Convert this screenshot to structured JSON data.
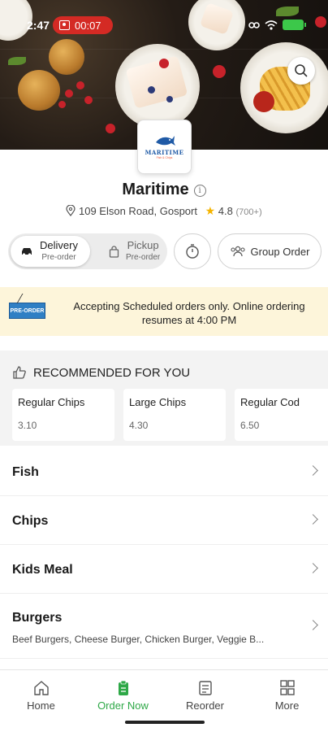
{
  "status_bar": {
    "time": "2:47",
    "recording": "00:07"
  },
  "restaurant": {
    "logo_text": "MARITIME",
    "logo_sub": "Fish & Chips",
    "name": "Maritime",
    "info_glyph": "i",
    "address": "109 Elson Road, Gosport",
    "rating": "4.8",
    "rating_count": "(700+)"
  },
  "order_modes": [
    {
      "label": "Delivery",
      "sub": "Pre-order",
      "active": true
    },
    {
      "label": "Pickup",
      "sub": "Pre-order",
      "active": false
    }
  ],
  "group_order_label": "Group Order",
  "banner": {
    "tag": "PRE-ORDER",
    "message": "Accepting Scheduled orders only. Online ordering resumes at 4:00 PM"
  },
  "recommended": {
    "heading": "RECOMMENDED FOR YOU",
    "items": [
      {
        "name": "Regular Chips",
        "price": "3.10"
      },
      {
        "name": "Large Chips",
        "price": "4.30"
      },
      {
        "name": "Regular Cod",
        "price": "6.50"
      }
    ]
  },
  "categories": [
    {
      "name": "Fish",
      "desc": ""
    },
    {
      "name": "Chips",
      "desc": ""
    },
    {
      "name": "Kids Meal",
      "desc": ""
    },
    {
      "name": "Burgers",
      "desc": "Beef Burgers, Cheese Burger, Chicken Burger, Veggie B..."
    }
  ],
  "tabs": [
    {
      "label": "Home",
      "icon": "home-icon",
      "active": false
    },
    {
      "label": "Order Now",
      "icon": "order-now-icon",
      "active": true
    },
    {
      "label": "Reorder",
      "icon": "reorder-icon",
      "active": false
    },
    {
      "label": "More",
      "icon": "grid-icon",
      "active": false
    }
  ],
  "colors": {
    "accent": "#2ea847",
    "banner_bg": "#fdf5da",
    "record": "#d42a24",
    "star": "#f5b400"
  }
}
